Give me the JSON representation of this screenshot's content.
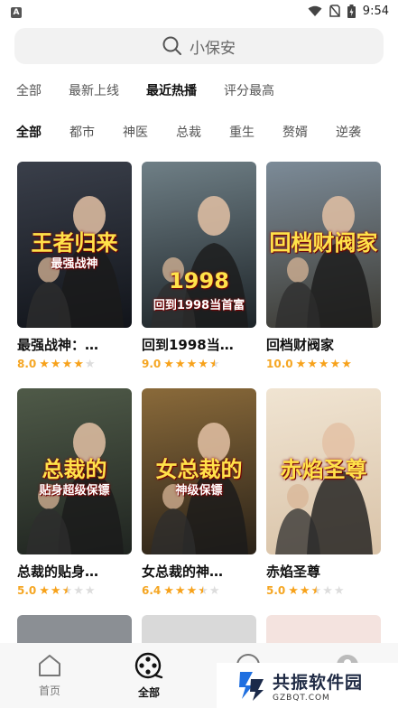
{
  "status_bar": {
    "app_badge": "A",
    "time": "9:54"
  },
  "search": {
    "placeholder_text": "小保安"
  },
  "sort_tabs": [
    {
      "label": "全部"
    },
    {
      "label": "最新上线"
    },
    {
      "label": "最近热播"
    },
    {
      "label": "评分最高"
    }
  ],
  "active_sort_index": 2,
  "category_tabs": [
    {
      "label": "全部"
    },
    {
      "label": "都市"
    },
    {
      "label": "神医"
    },
    {
      "label": "总裁"
    },
    {
      "label": "重生"
    },
    {
      "label": "赘婿"
    },
    {
      "label": "逆袭"
    }
  ],
  "active_category_index": 0,
  "dramas": [
    {
      "title": "最强战神：…",
      "score": "8.0",
      "stars": 4,
      "poster_text": "王者归来",
      "poster_sub": "最强战神",
      "colors": [
        "#3a3f4a",
        "#11141a"
      ]
    },
    {
      "title": "回到1998当…",
      "score": "9.0",
      "stars": 4.5,
      "poster_text": "1998",
      "poster_sub": "回到1998当首富",
      "colors": [
        "#6f7f86",
        "#1d2428"
      ]
    },
    {
      "title": "回档财阀家",
      "score": "10.0",
      "stars": 5,
      "poster_text": "回档财阀家",
      "poster_sub": "",
      "colors": [
        "#7c8b98",
        "#3c3a33"
      ]
    },
    {
      "title": "总裁的贴身…",
      "score": "5.0",
      "stars": 2.5,
      "poster_text": "总裁的",
      "poster_sub": "贴身超级保镖",
      "colors": [
        "#4f5a48",
        "#1f2420"
      ]
    },
    {
      "title": "女总裁的神…",
      "score": "6.4",
      "stars": 3.5,
      "poster_text": "女总裁的",
      "poster_sub": "神级保镖",
      "colors": [
        "#8a6a3a",
        "#2a2218"
      ]
    },
    {
      "title": "赤焰圣尊",
      "score": "5.0",
      "stars": 2.5,
      "poster_text": "赤焰圣尊",
      "poster_sub": "",
      "colors": [
        "#f0e4d2",
        "#d9c3a8"
      ]
    }
  ],
  "bottom_nav": [
    {
      "label": "首页",
      "icon": "home-icon"
    },
    {
      "label": "全部",
      "icon": "film-reel-icon"
    },
    {
      "label": "",
      "icon": "circle-icon"
    },
    {
      "label": "",
      "icon": "profile-icon"
    }
  ],
  "active_nav_index": 1,
  "watermark": {
    "title": "共振软件园",
    "sub": "GZBQT.COM"
  }
}
